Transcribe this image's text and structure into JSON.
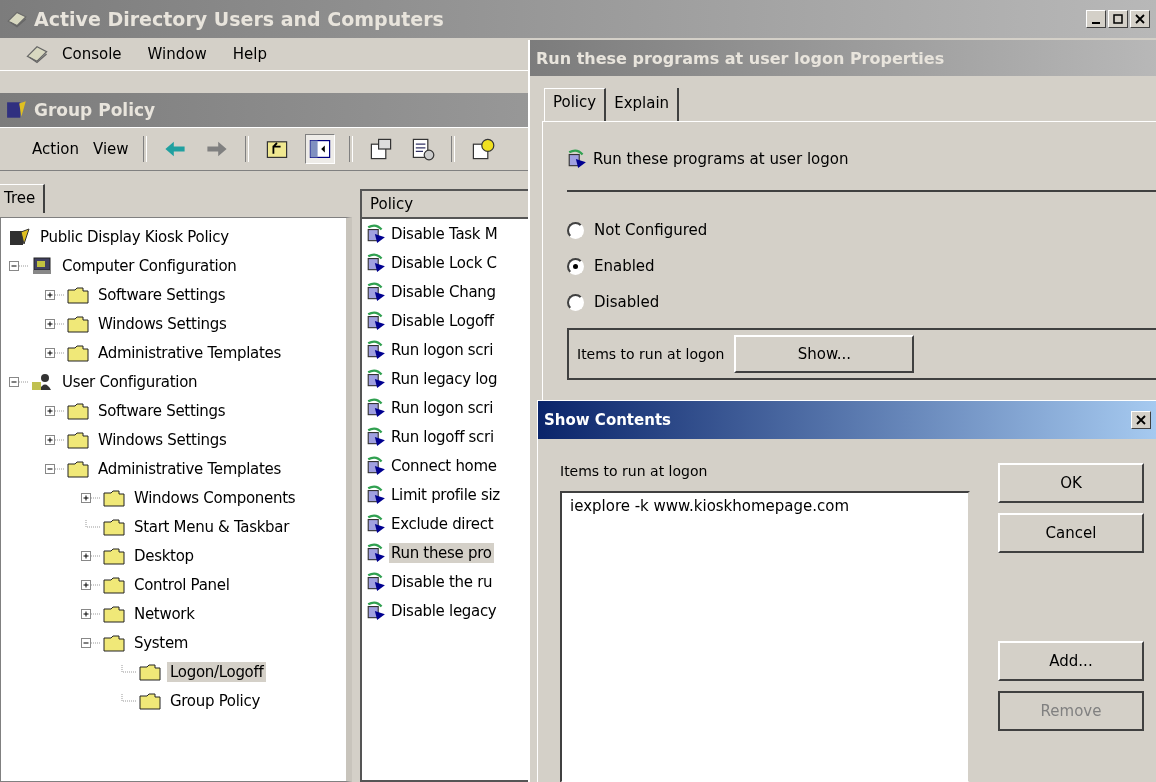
{
  "main_window": {
    "title": "Active Directory Users and Computers",
    "menu": [
      "Console",
      "Window",
      "Help"
    ]
  },
  "snapin": {
    "title": "Group Policy",
    "menu": [
      "Action",
      "View"
    ]
  },
  "tree_tab": {
    "label": "Tree",
    "selected": true
  },
  "tree": [
    {
      "label": "Public Display Kiosk Policy",
      "kind": "gpo",
      "selected": false,
      "children": [
        {
          "label": "Computer Configuration",
          "kind": "computer",
          "expanded": true,
          "selected": false,
          "children": [
            {
              "label": "Software Settings",
              "kind": "folder",
              "expanded": false,
              "selected": false
            },
            {
              "label": "Windows Settings",
              "kind": "folder",
              "expanded": false,
              "selected": false
            },
            {
              "label": "Administrative Templates",
              "kind": "folder",
              "expanded": false,
              "selected": false
            }
          ]
        },
        {
          "label": "User Configuration",
          "kind": "user",
          "expanded": true,
          "selected": false,
          "children": [
            {
              "label": "Software Settings",
              "kind": "folder",
              "expanded": false,
              "selected": false
            },
            {
              "label": "Windows Settings",
              "kind": "folder",
              "expanded": false,
              "selected": false
            },
            {
              "label": "Administrative Templates",
              "kind": "folder",
              "expanded": true,
              "selected": false,
              "children": [
                {
                  "label": "Windows Components",
                  "kind": "folder",
                  "expanded": false,
                  "selected": false
                },
                {
                  "label": "Start Menu & Taskbar",
                  "kind": "folder",
                  "selected": false
                },
                {
                  "label": "Desktop",
                  "kind": "folder",
                  "expanded": false,
                  "selected": false
                },
                {
                  "label": "Control Panel",
                  "kind": "folder",
                  "expanded": false,
                  "selected": false
                },
                {
                  "label": "Network",
                  "kind": "folder",
                  "expanded": false,
                  "selected": false
                },
                {
                  "label": "System",
                  "kind": "folder",
                  "expanded": true,
                  "selected": false,
                  "children": [
                    {
                      "label": "Logon/Logoff",
                      "kind": "folder",
                      "selected": true
                    },
                    {
                      "label": "Group Policy",
                      "kind": "folder",
                      "selected": false
                    }
                  ]
                }
              ]
            }
          ]
        }
      ]
    }
  ],
  "policy_list": {
    "column": "Policy",
    "rows": [
      {
        "label": "Disable Task M",
        "selected": false
      },
      {
        "label": "Disable Lock C",
        "selected": false
      },
      {
        "label": "Disable Chang",
        "selected": false
      },
      {
        "label": "Disable Logoff",
        "selected": false
      },
      {
        "label": "Run logon scri",
        "selected": false
      },
      {
        "label": "Run legacy log",
        "selected": false
      },
      {
        "label": "Run logon scri",
        "selected": false
      },
      {
        "label": "Run logoff scri",
        "selected": false
      },
      {
        "label": "Connect home",
        "selected": false
      },
      {
        "label": "Limit profile siz",
        "selected": false
      },
      {
        "label": "Exclude direct",
        "selected": false
      },
      {
        "label": "Run these pro",
        "selected": true
      },
      {
        "label": "Disable the ru",
        "selected": false
      },
      {
        "label": "Disable legacy",
        "selected": false
      }
    ]
  },
  "properties": {
    "title": "Run these programs at user logon Properties",
    "tabs": [
      {
        "label": "Policy",
        "selected": true
      },
      {
        "label": "Explain",
        "selected": false
      }
    ],
    "heading": "Run these programs at user logon",
    "options": [
      {
        "label": "Not Configured",
        "selected": false
      },
      {
        "label": "Enabled",
        "selected": true
      },
      {
        "label": "Disabled",
        "selected": false
      }
    ],
    "group_label": "Items to run at logon",
    "show_button": "Show..."
  },
  "show_contents": {
    "title": "Show Contents",
    "label": "Items to run at logon",
    "items": [
      "iexplore -k www.kioskhomepage.com"
    ],
    "buttons_top": [
      {
        "label": "OK",
        "disabled": false
      },
      {
        "label": "Cancel",
        "disabled": false
      }
    ],
    "buttons_bottom": [
      {
        "label": "Add...",
        "disabled": false
      },
      {
        "label": "Remove",
        "disabled": true
      }
    ]
  }
}
